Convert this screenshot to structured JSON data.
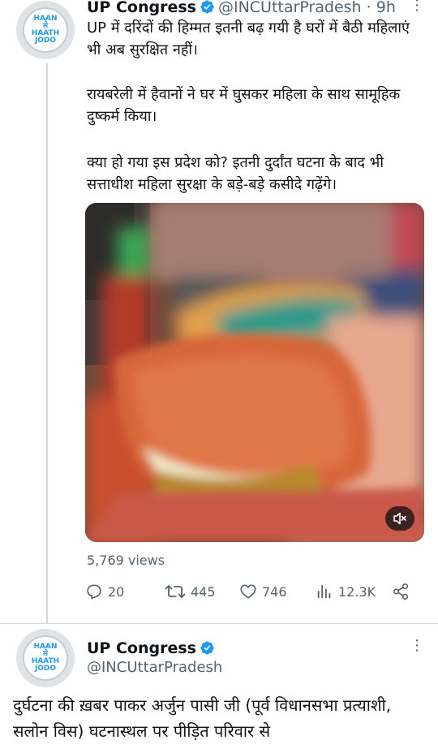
{
  "tweet1": {
    "author_name": "UP Congress",
    "handle": "@INCUttarPradesh",
    "separator": "·",
    "time": "9h",
    "avatar_logo_text": "HAAN\nसे\nHAATH\nJODO",
    "paragraphs": [
      "UP में दरिंदों की हिम्मत इतनी बढ़ गयी है घरों में बैठी महिलाएं भी अब सुरक्षित नहीं।",
      "रायबरेली में हैवानों ने घर में घुसकर महिला के साथ सामूहिक दुष्कर्म किया।",
      "क्या हो गया इस प्रदेश को? इतनी दुर्दांत घटना के बाद भी सत्ताधीश महिला सुरक्षा के बड़े-बड़े कसीदे गढ़ेंगे।"
    ],
    "views": "5,769 views",
    "stats": {
      "replies": "20",
      "retweets": "445",
      "likes": "746",
      "analytics": "12.3K"
    }
  },
  "tweet2": {
    "author_name": "UP Congress",
    "handle": "@INCUttarPradesh",
    "avatar_logo_text": "HAAN\nसे\nHAATH\nJODO",
    "text": "दुर्घटना की ख़बर पाकर अर्जुन पासी जी (पूर्व विधानसभा प्रत्याशी, सलोन विस) घटनास्थल पर पीड़ित परिवार से"
  },
  "colors": {
    "verified": "#1d9bf0",
    "secondary_text": "#536471",
    "divider": "#cfd9de"
  }
}
